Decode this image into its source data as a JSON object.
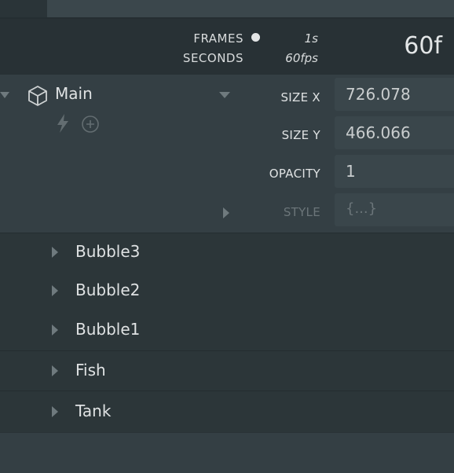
{
  "header": {
    "frames_label": "FRAMES",
    "seconds_label": "SECONDS",
    "seconds_value": "1s",
    "fps_value": "60fps",
    "frame_count": "60f"
  },
  "element": {
    "name": "Main",
    "icons": [
      "cube-icon",
      "lightning-icon",
      "add-circle-icon"
    ]
  },
  "properties": [
    {
      "label": "SIZE X",
      "value": "726.078"
    },
    {
      "label": "SIZE Y",
      "value": "466.066"
    },
    {
      "label": "OPACITY",
      "value": "1"
    },
    {
      "label": "STYLE",
      "value": "{...}"
    }
  ],
  "children": [
    "Bubble3",
    "Bubble2",
    "Bubble1",
    "Fish",
    "Tank"
  ]
}
